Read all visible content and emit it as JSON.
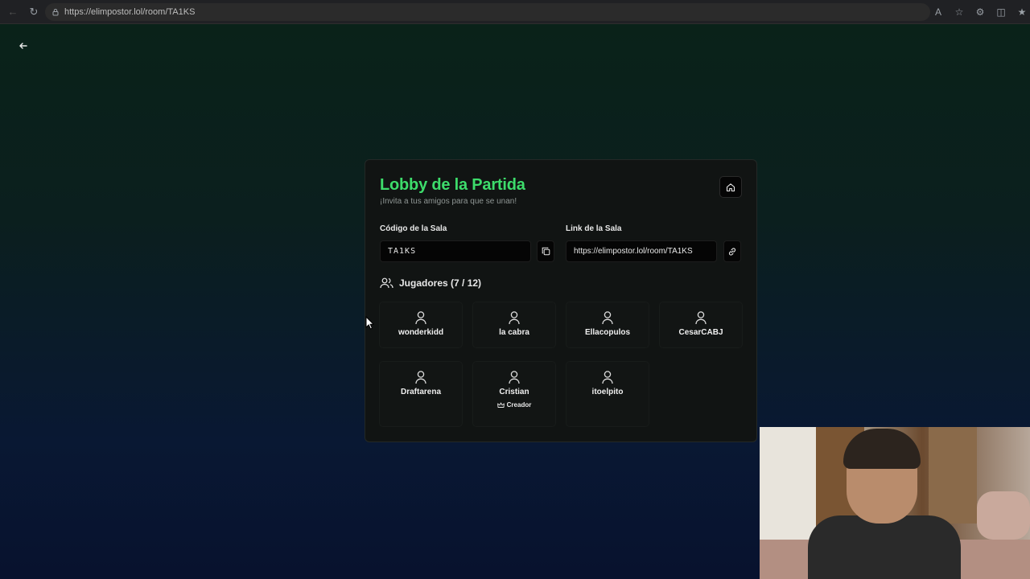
{
  "browser": {
    "url": "https://elimpostor.lol/room/TA1KS"
  },
  "lobby": {
    "title": "Lobby de la Partida",
    "subtitle": "¡Invita a tus amigos para que se unan!",
    "code_label": "Código de la Sala",
    "code_value": "TA1KS",
    "link_label": "Link de la Sala",
    "link_value": "https://elimpostor.lol/room/TA1KS",
    "players_header": "Jugadores (7 / 12)",
    "players": [
      {
        "name": "wonderkidd"
      },
      {
        "name": "la cabra"
      },
      {
        "name": "Ellacopulos"
      },
      {
        "name": "CesarCABJ"
      },
      {
        "name": "Draftarena"
      },
      {
        "name": "Cristian",
        "badge": "Creador"
      },
      {
        "name": "itoelpito"
      }
    ]
  },
  "colors": {
    "accent": "#3ddc6b"
  }
}
